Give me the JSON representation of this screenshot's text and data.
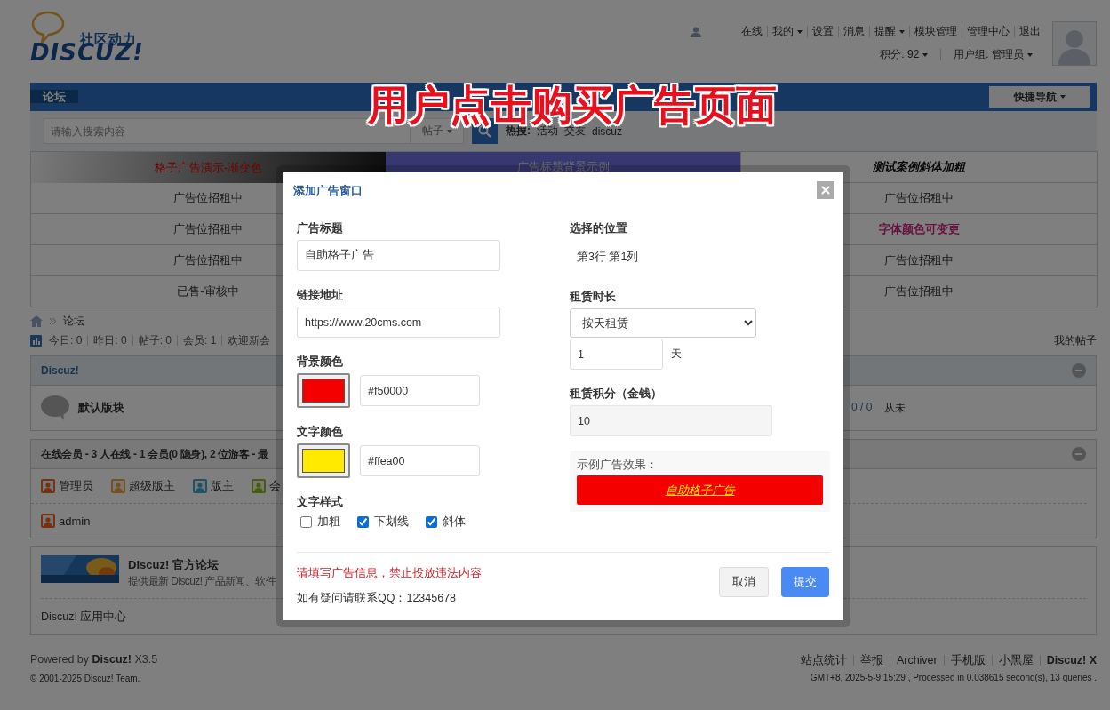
{
  "caption": "用户点击购买广告页面",
  "header": {
    "logo_tagline": "社区动力",
    "logo_text": "DISCUZ!",
    "user_links": [
      {
        "label": "在线",
        "dropdown": false
      },
      {
        "label": "我的",
        "dropdown": true
      },
      {
        "label": "设置",
        "dropdown": false
      },
      {
        "label": "消息",
        "dropdown": false
      },
      {
        "label": "提醒",
        "dropdown": true
      },
      {
        "label": "模块管理",
        "dropdown": false
      },
      {
        "label": "管理中心",
        "dropdown": false
      },
      {
        "label": "退出",
        "dropdown": false
      }
    ],
    "user_info": [
      {
        "label": "积分: 92",
        "dropdown": true
      },
      {
        "label": "用户组: 管理员",
        "dropdown": true
      }
    ]
  },
  "nav": {
    "tabs": [
      {
        "label": "论坛",
        "selected": true
      }
    ],
    "quick_nav": "快捷导航"
  },
  "search": {
    "placeholder": "请输入搜索内容",
    "scope": "帖子",
    "hot_label": "热搜:",
    "hot": [
      "活动",
      "交友",
      "discuz"
    ]
  },
  "ad_grid": {
    "header": [
      {
        "text": "格子广告演示-渐变色",
        "kind": "gradient"
      },
      {
        "text": "广告标题背景示例",
        "kind": "tinted"
      },
      {
        "text": "测试案例斜体加粗",
        "kind": "bold-italic"
      }
    ],
    "rows": [
      {
        "left": {
          "text": "广告位招租中",
          "kind": "plain"
        },
        "right": {
          "text": "广告位招租中",
          "kind": "plain"
        }
      },
      {
        "left": {
          "text": "广告位招租中",
          "kind": "plain"
        },
        "right": {
          "text": "字体颜色可变更",
          "kind": "featured"
        }
      },
      {
        "left": {
          "text": "广告位招租中",
          "kind": "plain"
        },
        "right": {
          "text": "广告位招租中",
          "kind": "plain"
        }
      },
      {
        "left": {
          "text": "已售-审核中",
          "kind": "plain"
        },
        "right": {
          "text": "广告位招租中",
          "kind": "plain"
        }
      }
    ]
  },
  "breadcrumb": [
    "论坛"
  ],
  "stats": [
    "今日: 0",
    "昨日: 0",
    "帖子: 0",
    "会员: 1",
    "欢迎新会"
  ],
  "my_posts": "我的帖子",
  "forum_section": {
    "title": "Discuz!",
    "forums": [
      {
        "name": "默认版块",
        "counts": "0 / 0",
        "last_post": "从未"
      }
    ]
  },
  "online": {
    "title": "在线会员 - 3 人在线 - 1 会员(0 隐身), 2 位游客 - 最",
    "legend": [
      {
        "label": "管理员",
        "kind": "admin"
      },
      {
        "label": "超级版主",
        "kind": "super-moderator"
      },
      {
        "label": "版主",
        "kind": "moderator"
      },
      {
        "label": "会",
        "kind": "member"
      }
    ],
    "members": [
      {
        "name": "admin",
        "kind": "admin"
      }
    ]
  },
  "links": {
    "title": "Discuz! 官方论坛",
    "description": "提供最新 Discuz! 产品新闻、软件",
    "more": [
      "Discuz! 应用中心"
    ]
  },
  "footer": {
    "powered": "Powered by **Discuz!** X3.5",
    "copyright": "© 2001-2025 Discuz! Team.",
    "links": [
      "站点统计",
      "举报",
      "Archiver",
      "手机版",
      "小黑屋",
      "Discuz! X"
    ],
    "stats": "GMT+8, 2025-5-9 15:29 , Processed in 0.038615 second(s), 13 queries ."
  },
  "modal": {
    "title": "添加广告窗口",
    "ad_title": {
      "label": "广告标题",
      "value": "自助格子广告"
    },
    "link": {
      "label": "链接地址",
      "value": "https://www.20cms.com"
    },
    "background_color": {
      "label": "背景颜色",
      "value": "#f50000"
    },
    "text_color": {
      "label": "文字颜色",
      "value": "#ffea00"
    },
    "text_style": {
      "label": "文字样式",
      "options": [
        {
          "label": "加粗",
          "checked": false
        },
        {
          "label": "下划线",
          "checked": true
        },
        {
          "label": "斜体",
          "checked": true
        }
      ]
    },
    "position": {
      "label": "选择的位置",
      "value": "第3行 第1列"
    },
    "duration": {
      "label": "租赁时长",
      "mode": "按天租赁",
      "amount": "1",
      "unit": "天"
    },
    "price": {
      "label": "租赁积分（金钱）",
      "value": "10"
    },
    "preview": {
      "label": "示例广告效果：",
      "text": "自助格子广告"
    },
    "warning": "请填写广告信息，禁止投放违法内容",
    "contact": "如有疑问请联系QQ：12345678",
    "buttons": {
      "cancel": "取消",
      "submit": "提交"
    }
  }
}
